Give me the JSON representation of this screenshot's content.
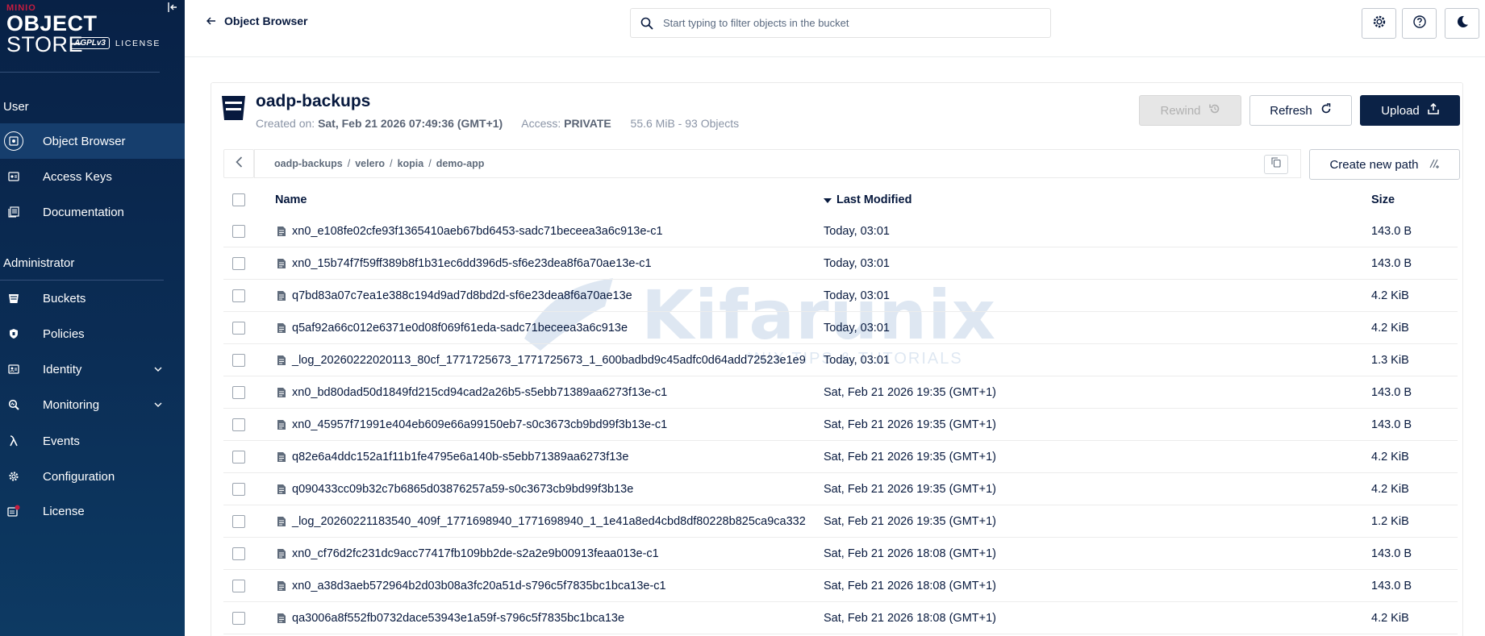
{
  "sidebar": {
    "logo": {
      "brand": "MINIO",
      "product_bold": "OBJECT",
      "product": "STORE",
      "license_badge": "AGPLv3",
      "license": "LICENSE"
    },
    "section_user": "User",
    "section_admin": "Administrator",
    "items": [
      {
        "label": "Object Browser",
        "icon": "object-browser-icon"
      },
      {
        "label": "Access Keys",
        "icon": "access-keys-icon"
      },
      {
        "label": "Documentation",
        "icon": "documentation-icon"
      },
      {
        "label": "Buckets",
        "icon": "buckets-icon"
      },
      {
        "label": "Policies",
        "icon": "policies-icon"
      },
      {
        "label": "Identity",
        "icon": "identity-icon"
      },
      {
        "label": "Monitoring",
        "icon": "monitoring-icon"
      },
      {
        "label": "Events",
        "icon": "lambda-icon"
      },
      {
        "label": "Configuration",
        "icon": "gear-icon"
      },
      {
        "label": "License",
        "icon": "license-icon"
      }
    ]
  },
  "header": {
    "back_label": "Object Browser",
    "search_placeholder": "Start typing to filter objects in the bucket"
  },
  "bucket": {
    "name": "oadp-backups",
    "created_label": "Created on:",
    "created_value": "Sat, Feb 21 2026 07:49:36 (GMT+1)",
    "access_label": "Access:",
    "access_value": "PRIVATE",
    "usage": "55.6 MiB - 93 Objects",
    "rewind_label": "Rewind",
    "refresh_label": "Refresh",
    "upload_label": "Upload",
    "create_path_label": "Create new path"
  },
  "breadcrumb": [
    "oadp-backups",
    "velero",
    "kopia",
    "demo-app"
  ],
  "table": {
    "columns": {
      "name": "Name",
      "modified": "Last Modified",
      "size": "Size"
    },
    "rows": [
      {
        "name": "xn0_e108fe02cfe93f1365410aeb67bd6453-sadc71beceea3a6c913e-c1",
        "modified": "Today, 03:01",
        "size": "143.0 B"
      },
      {
        "name": "xn0_15b74f7f59ff389b8f1b31ec6dd396d5-sf6e23dea8f6a70ae13e-c1",
        "modified": "Today, 03:01",
        "size": "143.0 B"
      },
      {
        "name": "q7bd83a07c7ea1e388c194d9ad7d8bd2d-sf6e23dea8f6a70ae13e",
        "modified": "Today, 03:01",
        "size": "4.2 KiB"
      },
      {
        "name": "q5af92a66c012e6371e0d08f069f61eda-sadc71beceea3a6c913e",
        "modified": "Today, 03:01",
        "size": "4.2 KiB"
      },
      {
        "name": "_log_20260222020113_80cf_1771725673_1771725673_1_600badbd9c45adfc0d64add72523e1e9",
        "modified": "Today, 03:01",
        "size": "1.3 KiB"
      },
      {
        "name": "xn0_bd80dad50d1849fd215cd94cad2a26b5-s5ebb71389aa6273f13e-c1",
        "modified": "Sat, Feb 21 2026 19:35 (GMT+1)",
        "size": "143.0 B"
      },
      {
        "name": "xn0_45957f71991e404eb609e66a99150eb7-s0c3673cb9bd99f3b13e-c1",
        "modified": "Sat, Feb 21 2026 19:35 (GMT+1)",
        "size": "143.0 B"
      },
      {
        "name": "q82e6a4ddc152a1f11b1fe4795e6a140b-s5ebb71389aa6273f13e",
        "modified": "Sat, Feb 21 2026 19:35 (GMT+1)",
        "size": "4.2 KiB"
      },
      {
        "name": "q090433cc09b32c7b6865d03876257a59-s0c3673cb9bd99f3b13e",
        "modified": "Sat, Feb 21 2026 19:35 (GMT+1)",
        "size": "4.2 KiB"
      },
      {
        "name": "_log_20260221183540_409f_1771698940_1771698940_1_1e41a8ed4cbd8df80228b825ca9ca332",
        "modified": "Sat, Feb 21 2026 19:35 (GMT+1)",
        "size": "1.2 KiB"
      },
      {
        "name": "xn0_cf76d2fc231dc9acc77417fb109bb2de-s2a2e9b00913feaa013e-c1",
        "modified": "Sat, Feb 21 2026 18:08 (GMT+1)",
        "size": "143.0 B"
      },
      {
        "name": "xn0_a38d3aeb572964b2d03b08a3fc20a51d-s796c5f7835bc1bca13e-c1",
        "modified": "Sat, Feb 21 2026 18:08 (GMT+1)",
        "size": "143.0 B"
      },
      {
        "name": "qa3006a8f552fb0732dace53943e1a59f-s796c5f7835bc1bca13e",
        "modified": "Sat, Feb 21 2026 18:08 (GMT+1)",
        "size": "4.2 KiB"
      }
    ]
  },
  "watermark": {
    "text": "Kifarunix",
    "sub": "*NIX TIPS & TUTORIALS"
  },
  "colors": {
    "sidebar": "#082146",
    "active_item": "#163e6d",
    "primary": "#0b2246",
    "license_dot": "#c51c3f"
  }
}
